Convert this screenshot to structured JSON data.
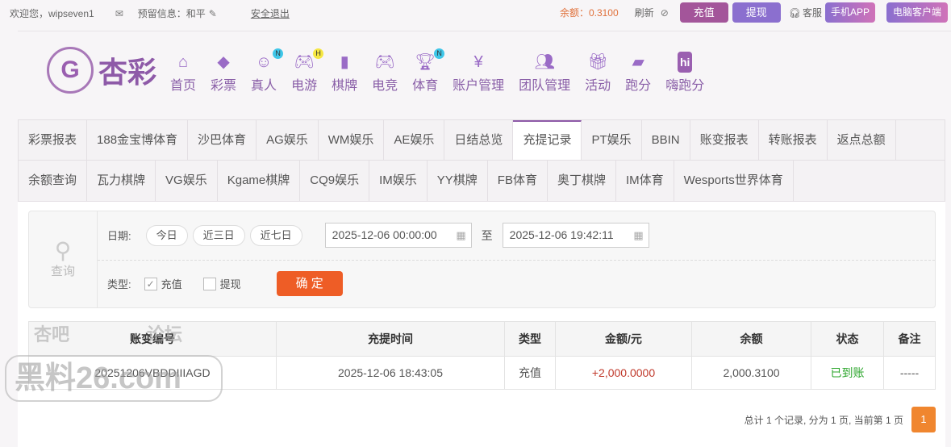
{
  "topbar": {
    "welcome": "欢迎您，wipseven1",
    "reserved": "预留信息：和平",
    "logout": "安全退出",
    "balance": "余额：0.3100",
    "refresh": "刷新",
    "deposit": "充值",
    "withdraw": "提现",
    "service": "客服",
    "mobile_app": "手机APP",
    "pc_client": "电脑客户端"
  },
  "logo": {
    "text": "杏彩"
  },
  "nav": [
    {
      "label": "首页",
      "icon": "home-icon"
    },
    {
      "label": "彩票",
      "icon": "ticket-icon"
    },
    {
      "label": "真人",
      "icon": "dealer-icon",
      "badge": "N"
    },
    {
      "label": "电游",
      "icon": "gamepad-icon",
      "badge": "H"
    },
    {
      "label": "棋牌",
      "icon": "cards-icon"
    },
    {
      "label": "电竞",
      "icon": "gamepad-icon"
    },
    {
      "label": "体育",
      "icon": "trophy-icon",
      "badge": "N"
    },
    {
      "label": "账户管理",
      "icon": "yen-icon"
    },
    {
      "label": "团队管理",
      "icon": "team-icon"
    },
    {
      "label": "活动",
      "icon": "gift-icon"
    },
    {
      "label": "跑分",
      "icon": "rhino-icon"
    },
    {
      "label": "嗨跑分",
      "icon": "hi-icon"
    }
  ],
  "tabs_row1": [
    "彩票报表",
    "188金宝博体育",
    "沙巴体育",
    "AG娱乐",
    "WM娱乐",
    "AE娱乐",
    "日结总览",
    "充提记录",
    "PT娱乐",
    "BBIN",
    "账变报表",
    "转账报表",
    "返点总额"
  ],
  "tabs_row2": [
    "余额查询",
    "瓦力棋牌",
    "VG娱乐",
    "Kgame棋牌",
    "CQ9娱乐",
    "IM娱乐",
    "YY棋牌",
    "FB体育",
    "奥丁棋牌",
    "IM体育",
    "Wesports世界体育"
  ],
  "active_tab": "充提记录",
  "filter": {
    "search_label": "查询",
    "date_label": "日期:",
    "today": "今日",
    "three_days": "近三日",
    "seven_days": "近七日",
    "start": "2025-12-06 00:00:00",
    "to": "至",
    "end": "2025-12-06 19:42:11",
    "type_label": "类型:",
    "type_deposit": "充值",
    "type_withdraw": "提现",
    "deposit_checked": true,
    "withdraw_checked": false,
    "confirm": "确 定"
  },
  "table": {
    "headers": [
      "账变编号",
      "充提时间",
      "类型",
      "金额/元",
      "余额",
      "状态",
      "备注"
    ],
    "rows": [
      [
        "20251206VBDDIIIAGD",
        "2025-12-06 18:43:05",
        "充值",
        "+2,000.0000",
        "2,000.3100",
        "已到账",
        "-----"
      ]
    ]
  },
  "pagination": {
    "summary": "总计 1 个记录, 分为 1 页, 当前第 1 页",
    "current": "1"
  },
  "watermark": {
    "line1": "杏吧 论坛",
    "line2": "黑料26.com"
  },
  "colors": {
    "brand": "#8e5aa8",
    "deposit_btn": "#a3559a",
    "withdraw_btn": "#8b6fcf",
    "amount": "#c0392b",
    "status_ok": "#2aa52a",
    "confirm_btn": "#ee5d26",
    "balance": "#e0703a"
  }
}
